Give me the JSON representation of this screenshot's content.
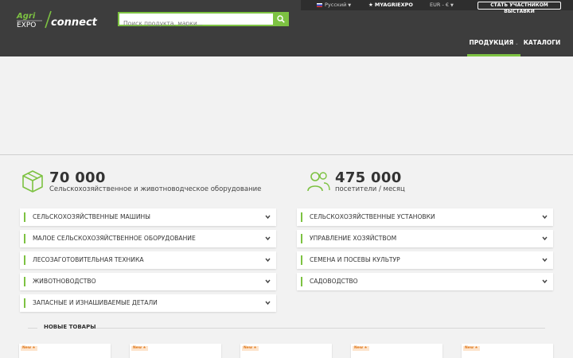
{
  "header": {
    "language": "Русский",
    "my_account": "MYAGRIEXPO",
    "currency": "EUR - €",
    "exhibitor_button": "СТАТЬ УЧАСТНИКОМ ВЫСТАВКИ",
    "logo_text": "AgriEXPO Connect",
    "search_placeholder": "Поиск продукта, марки...",
    "nav": {
      "products": "ПРОДУКЦИЯ",
      "catalogs": "КАТАЛОГИ"
    }
  },
  "stats": [
    {
      "number": "70 000",
      "label": "Сельскохозяйственное и животноводческое оборудование",
      "icon": "box-icon"
    },
    {
      "number": "475 000",
      "label": "посетители / месяц",
      "icon": "users-icon"
    }
  ],
  "categories_left": [
    "СЕЛЬСКОХОЗЯЙСТВЕННЫЕ МАШИНЫ",
    "МАЛОЕ СЕЛЬСКОХОЗЯЙСТВЕННОЕ ОБОРУДОВАНИЕ",
    "ЛЕСОЗАГОТОВИТЕЛЬНАЯ ТЕХНИКА",
    "ЖИВОТНОВОДСТВО",
    "ЗАПАСНЫЕ И ИЗНАШИВАЕМЫЕ ДЕТАЛИ"
  ],
  "categories_right": [
    "СЕЛЬСКОХОЗЯЙСТВЕННЫЕ УСТАНОВКИ",
    "УПРАВЛЕНИЕ ХОЗЯЙСТВОМ",
    "СЕМЕНА И ПОСЕВЫ КУЛЬТУР",
    "САДОВОДСТВО"
  ],
  "new_products": {
    "title": "НОВЫЕ ТОВАРЫ",
    "badge": "New ★",
    "count": 5
  },
  "colors": {
    "accent": "#7dc242",
    "header_bg": "#3d3d3d",
    "page_bg": "#f2f2f2"
  }
}
